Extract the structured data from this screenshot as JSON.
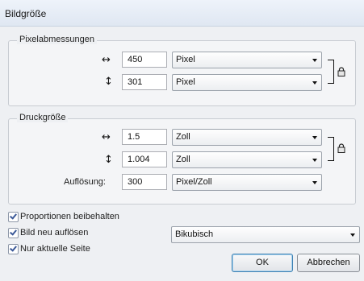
{
  "window": {
    "title": "Bildgröße"
  },
  "pixel_dimensions": {
    "legend": "Pixelabmessungen",
    "width": {
      "icon": "horizontal-arrow-icon",
      "value": "450",
      "unit": "Pixel"
    },
    "height": {
      "icon": "vertical-arrow-icon",
      "value": "301",
      "unit": "Pixel"
    }
  },
  "print_size": {
    "legend": "Druckgröße",
    "width": {
      "icon": "horizontal-arrow-icon",
      "value": "1.5",
      "unit": "Zoll"
    },
    "height": {
      "icon": "vertical-arrow-icon",
      "value": "1.004",
      "unit": "Zoll"
    },
    "resolution": {
      "label": "Auflösung:",
      "value": "300",
      "unit": "Pixel/Zoll"
    }
  },
  "options": {
    "keep_proportions": {
      "label": "Proportionen beibehalten",
      "checked": true
    },
    "resample": {
      "label": "Bild neu auflösen",
      "checked": true,
      "method": "Bikubisch"
    },
    "current_page_only": {
      "label": "Nur aktuelle Seite",
      "checked": true
    }
  },
  "buttons": {
    "ok": "OK",
    "cancel": "Abbrechen"
  },
  "glyphs": {
    "horizontal_arrow": "↔",
    "vertical_arrow": "↕"
  }
}
